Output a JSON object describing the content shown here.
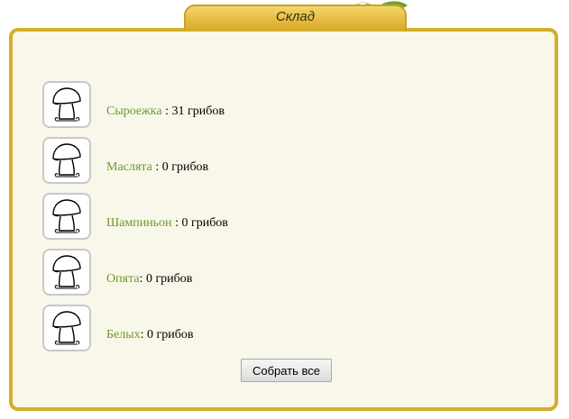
{
  "window": {
    "title": "Склад"
  },
  "items": [
    {
      "name": "Сыроежка",
      "sep": " : ",
      "count": "31 грибов",
      "icon": "mushroom-icon"
    },
    {
      "name": "Маслята",
      "sep": " : ",
      "count": "0 грибов",
      "icon": "mushroom-icon"
    },
    {
      "name": "Шампиньон",
      "sep": " : ",
      "count": "0 грибов",
      "icon": "mushroom-icon"
    },
    {
      "name": "Опята",
      "sep": ": ",
      "count": "0 грибов",
      "icon": "mushroom-icon"
    },
    {
      "name": "Белых",
      "sep": ": ",
      "count": "0 грибов",
      "icon": "mushroom-icon"
    }
  ],
  "actions": {
    "collect_all_label": "Собрать все"
  },
  "colors": {
    "frame_border": "#d4ad2a",
    "panel_background": "#f9f7ea",
    "item_name": "#6a9a2a"
  }
}
